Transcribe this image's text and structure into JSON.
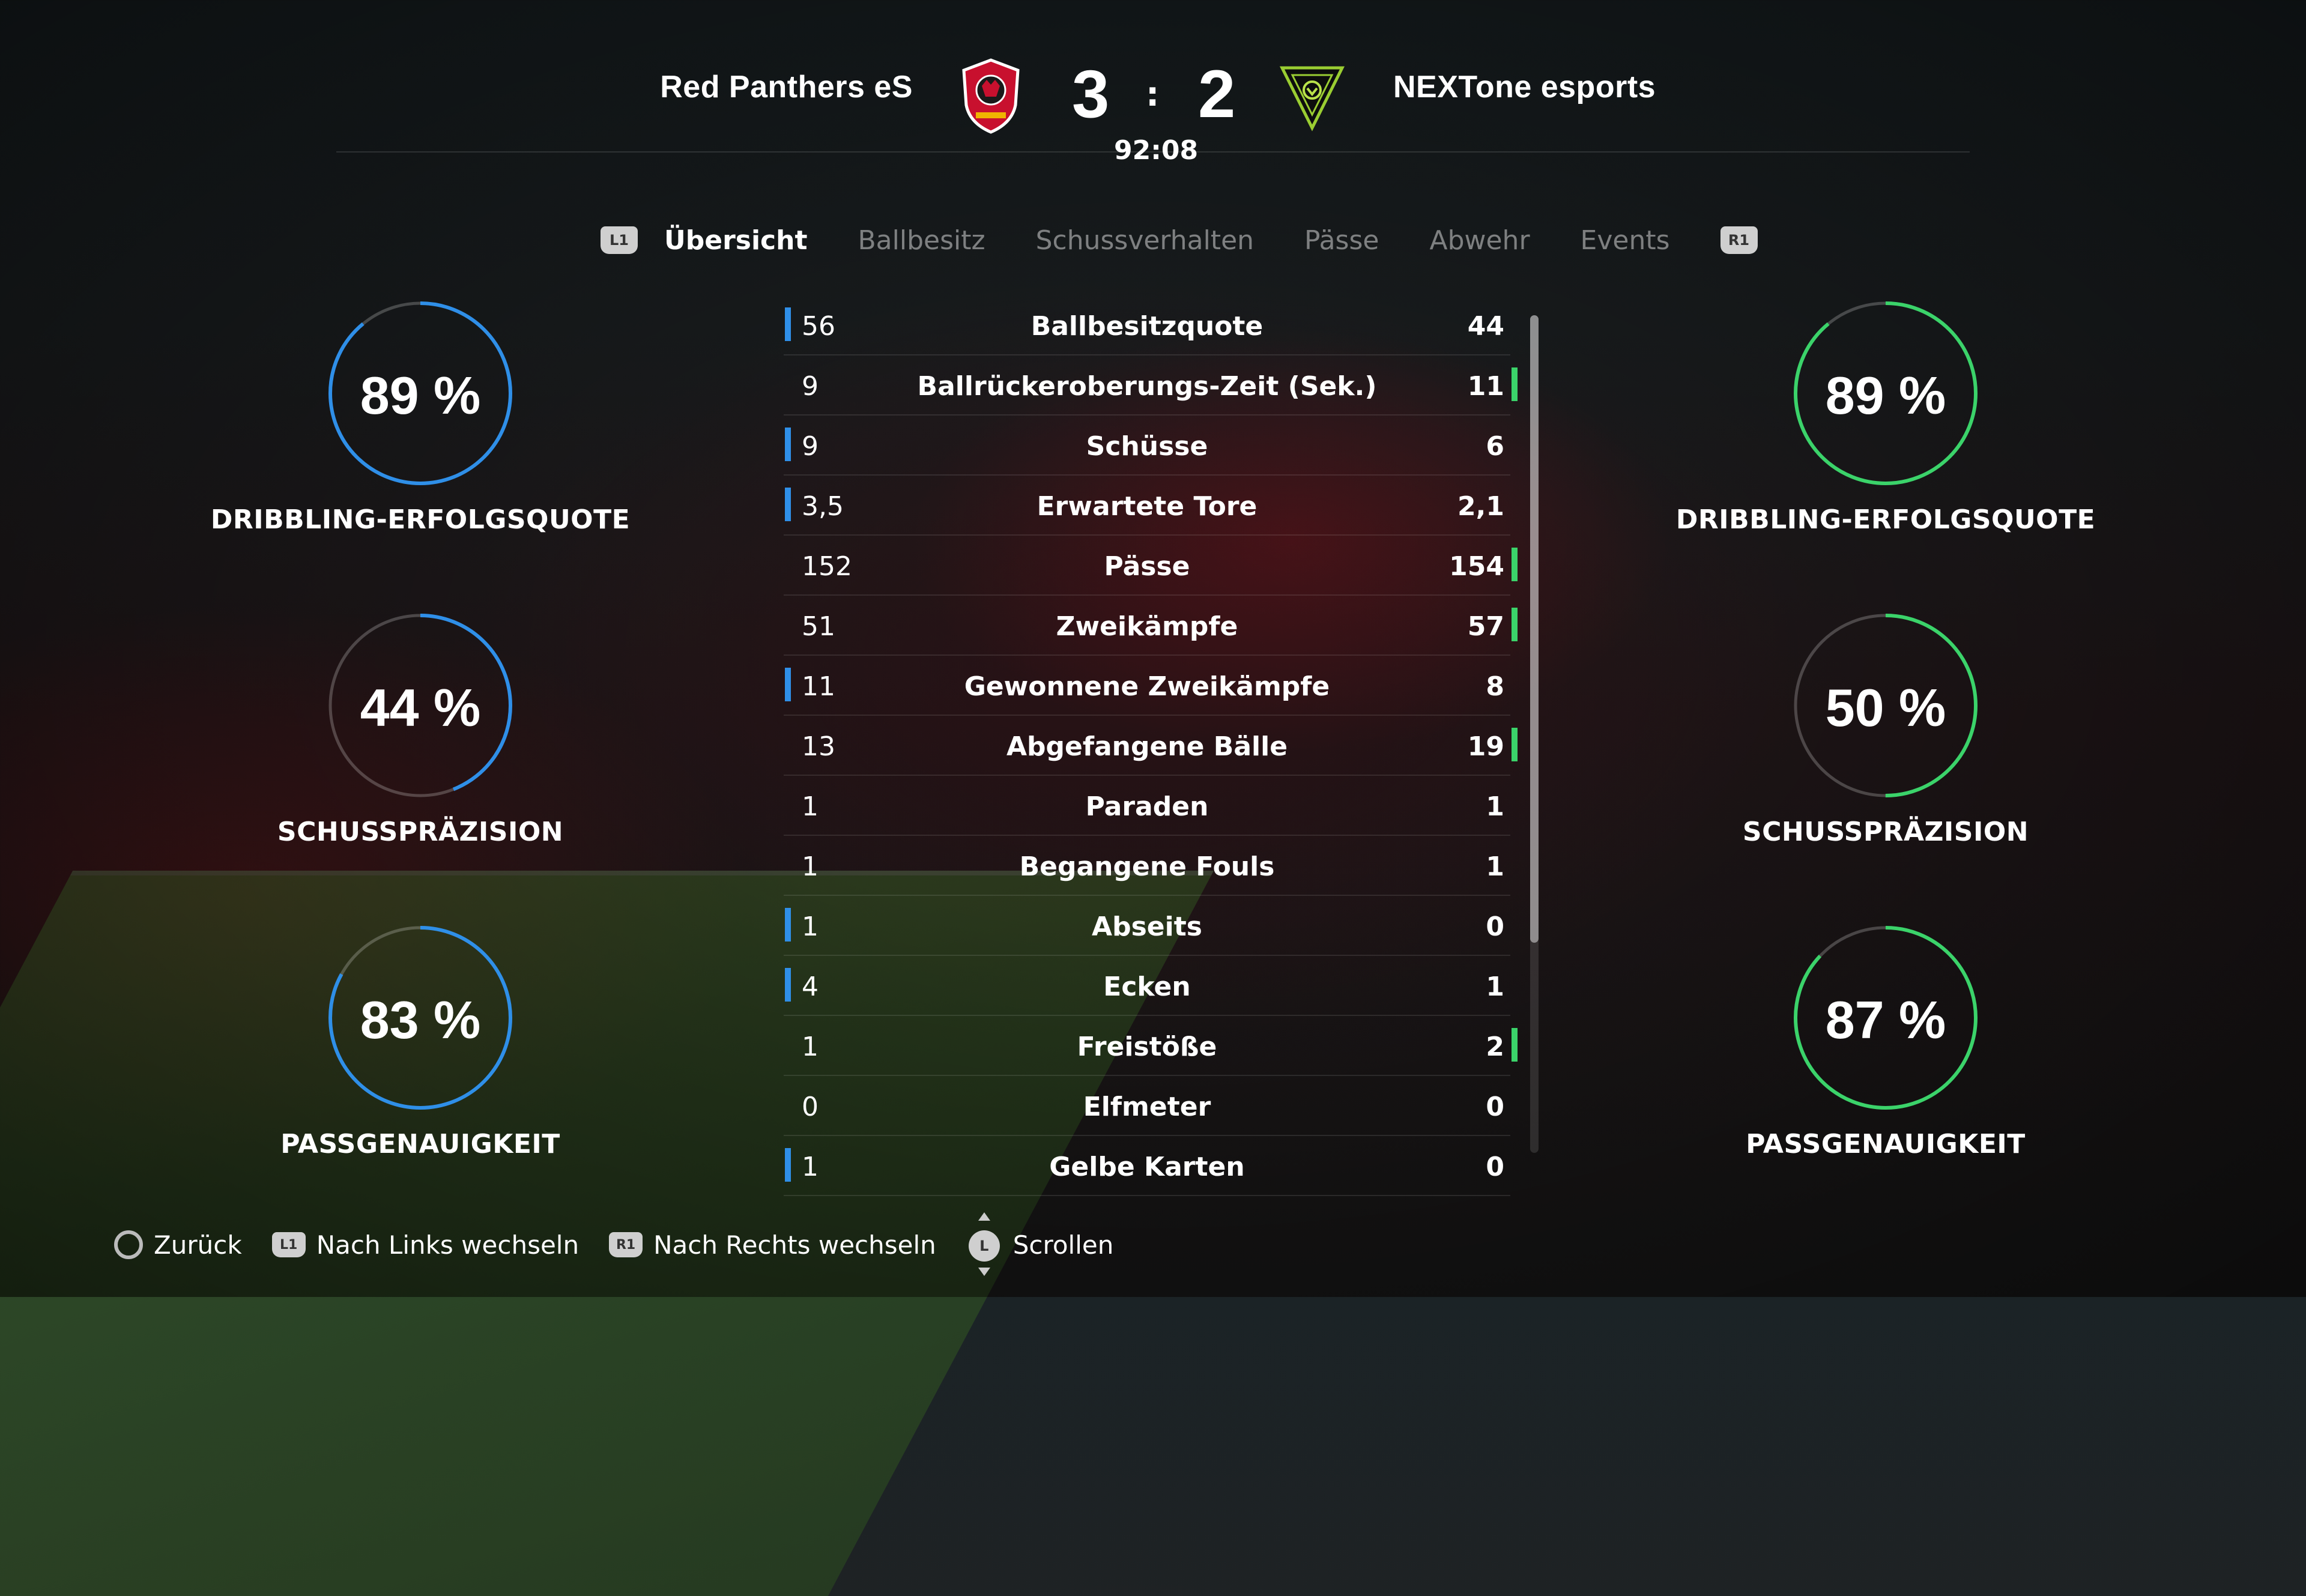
{
  "header": {
    "home_team": "Red Panthers eS",
    "away_team": "NEXTone esports",
    "home_score": "3",
    "away_score": "2",
    "separator": ":",
    "clock": "92:08"
  },
  "tabs": {
    "left_button": "L1",
    "right_button": "R1",
    "items": [
      "Übersicht",
      "Ballbesitz",
      "Schussverhalten",
      "Pässe",
      "Abwehr",
      "Events"
    ],
    "active": "Übersicht"
  },
  "colors": {
    "home_accent": "#2f8fe8",
    "away_accent": "#3bd36a"
  },
  "home_rings": [
    {
      "value": "89 %",
      "label": "DRIBBLING-ERFOLGSQUOTE",
      "percent": 89
    },
    {
      "value": "44 %",
      "label": "SCHUSSPRÄZISION",
      "percent": 44
    },
    {
      "value": "83 %",
      "label": "PASSGENAUIGKEIT",
      "percent": 83
    }
  ],
  "away_rings": [
    {
      "value": "89 %",
      "label": "DRIBBLING-ERFOLGSQUOTE",
      "percent": 89
    },
    {
      "value": "50 %",
      "label": "SCHUSSPRÄZISION",
      "percent": 50
    },
    {
      "value": "87 %",
      "label": "PASSGENAUIGKEIT",
      "percent": 87
    }
  ],
  "stats": [
    {
      "label": "Ballbesitzquote",
      "home": "56",
      "away": "44",
      "leader": "home"
    },
    {
      "label": "Ballrückeroberungs-Zeit (Sek.)",
      "home": "9",
      "away": "11",
      "leader": "away"
    },
    {
      "label": "Schüsse",
      "home": "9",
      "away": "6",
      "leader": "home"
    },
    {
      "label": "Erwartete Tore",
      "home": "3,5",
      "away": "2,1",
      "leader": "home"
    },
    {
      "label": "Pässe",
      "home": "152",
      "away": "154",
      "leader": "away"
    },
    {
      "label": "Zweikämpfe",
      "home": "51",
      "away": "57",
      "leader": "away"
    },
    {
      "label": "Gewonnene Zweikämpfe",
      "home": "11",
      "away": "8",
      "leader": "home"
    },
    {
      "label": "Abgefangene Bälle",
      "home": "13",
      "away": "19",
      "leader": "away"
    },
    {
      "label": "Paraden",
      "home": "1",
      "away": "1",
      "leader": "none"
    },
    {
      "label": "Begangene Fouls",
      "home": "1",
      "away": "1",
      "leader": "none"
    },
    {
      "label": "Abseits",
      "home": "1",
      "away": "0",
      "leader": "home"
    },
    {
      "label": "Ecken",
      "home": "4",
      "away": "1",
      "leader": "home"
    },
    {
      "label": "Freistöße",
      "home": "1",
      "away": "2",
      "leader": "away"
    },
    {
      "label": "Elfmeter",
      "home": "0",
      "away": "0",
      "leader": "none"
    },
    {
      "label": "Gelbe Karten",
      "home": "1",
      "away": "0",
      "leader": "home"
    }
  ],
  "footer": {
    "back_label": "Zurück",
    "left_button": "L1",
    "left_label": "Nach Links wechseln",
    "right_button": "R1",
    "right_label": "Nach Rechts wechseln",
    "stick_button": "L",
    "scroll_label": "Scrollen"
  }
}
